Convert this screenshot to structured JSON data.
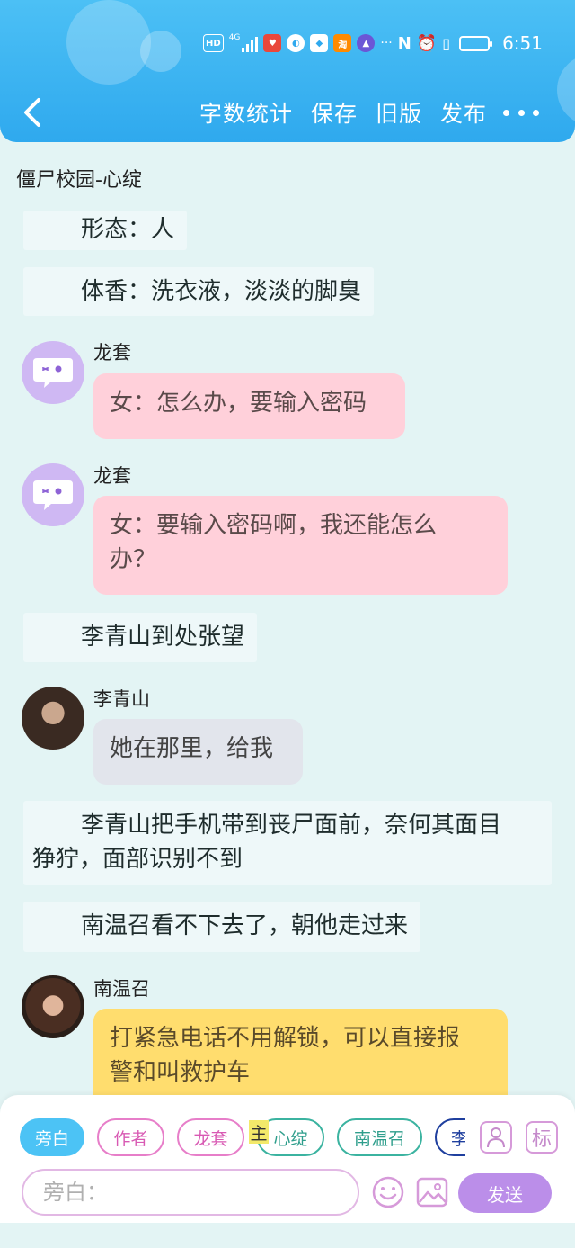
{
  "status_bar": {
    "hd": "HD",
    "network": "4G",
    "time": "6:51"
  },
  "header": {
    "actions": [
      "字数统计",
      "保存",
      "旧版",
      "发布"
    ]
  },
  "doc_title": "僵尸校园-心绽",
  "messages": [
    {
      "type": "narration",
      "text": "形态：人"
    },
    {
      "type": "narration",
      "text": "体香：洗衣液，淡淡的脚臭"
    },
    {
      "type": "dialog",
      "speaker": "龙套",
      "lines": [
        "女：怎么办，要输入密码"
      ]
    },
    {
      "type": "dialog",
      "speaker": "龙套",
      "lines": [
        "女：要输入密码啊，我还能怎么",
        "办？"
      ]
    },
    {
      "type": "narration",
      "text": "李青山到处张望"
    },
    {
      "type": "dialog",
      "speaker": "李青山",
      "lines": [
        "她在那里，给我"
      ]
    },
    {
      "type": "narration",
      "lines": [
        "李青山把手机带到丧尸面前，奈何其面目",
        "狰狞，面部识别不到"
      ]
    },
    {
      "type": "narration",
      "text": "南温召看不下去了，朝他走过来"
    },
    {
      "type": "dialog",
      "speaker": "南温召",
      "lines": [
        "打紧急电话不用解锁，可以直接报",
        "警和叫救护车"
      ]
    }
  ],
  "roles": [
    "旁白",
    "作者",
    "龙套",
    "心绽",
    "南温召",
    "李"
  ],
  "main_badge": "主",
  "tools": {
    "tag_label": "标"
  },
  "composer": {
    "placeholder": "旁白：",
    "send_label": "发送"
  },
  "colors": {
    "header": "#2fa9ee",
    "background": "#e3f4f4",
    "pink_bubble": "#ffd0da",
    "gray_bubble": "#e2e5ec",
    "yellow_bubble": "#ffdd6e",
    "send": "#bb8ee9",
    "active_role": "#4cc3f5"
  }
}
